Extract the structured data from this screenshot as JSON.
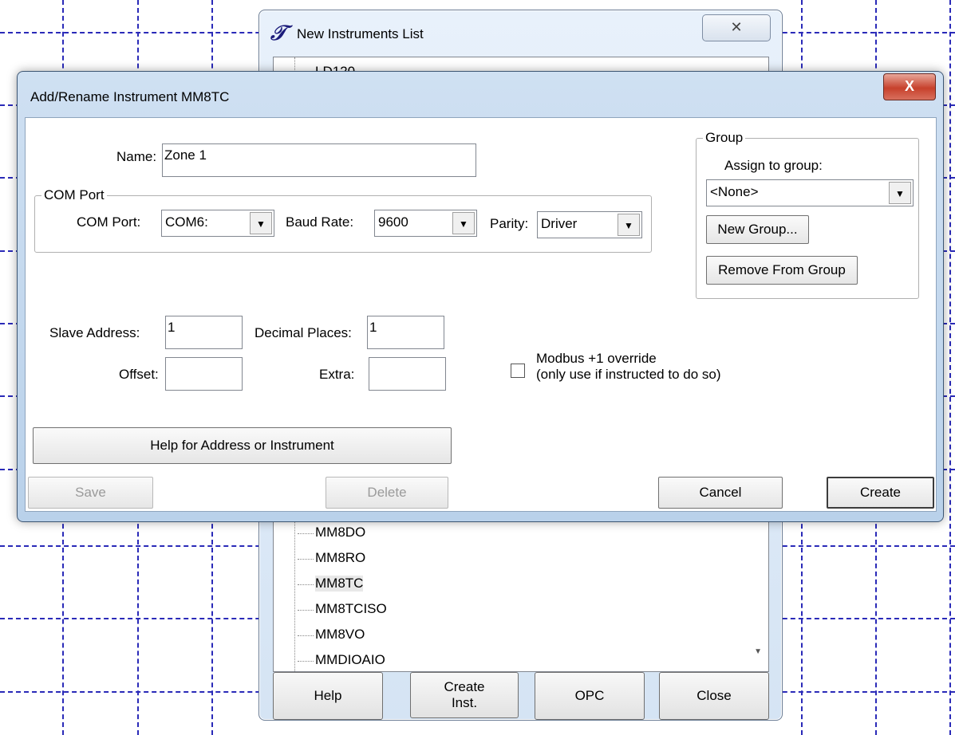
{
  "back_window": {
    "title": "New Instruments List",
    "title_icon": "𝒯",
    "close_glyph": "✕",
    "list_items": [
      {
        "label": "LD120",
        "selected": false
      },
      {
        "label": "MM8DO",
        "selected": false
      },
      {
        "label": "MM8RO",
        "selected": false
      },
      {
        "label": "MM8TC",
        "selected": true
      },
      {
        "label": "MM8TCISO",
        "selected": false
      },
      {
        "label": "MM8VO",
        "selected": false
      },
      {
        "label": "MMDIOAIO",
        "selected": false
      }
    ],
    "buttons": {
      "help": "Help",
      "create_inst": "Create Inst.",
      "opc": "OPC",
      "close": "Close"
    }
  },
  "dialog": {
    "title": "Add/Rename Instrument MM8TC",
    "close_glyph": "X",
    "name_label": "Name:",
    "name_value": "Zone 1",
    "com_group_label": "COM Port",
    "com_port_label": "COM Port:",
    "com_port_value": "COM6:",
    "baud_label": "Baud Rate:",
    "baud_value": "9600",
    "parity_label": "Parity:",
    "parity_value": "Driver",
    "group": {
      "label": "Group",
      "assign_label": "Assign to group:",
      "assign_value": "<None>",
      "new_group": "New Group...",
      "remove_from_group": "Remove From Group"
    },
    "slave_address_label": "Slave Address:",
    "slave_address_value": "1",
    "decimal_places_label": "Decimal Places:",
    "decimal_places_value": "1",
    "offset_label": "Offset:",
    "offset_value": "",
    "extra_label": "Extra:",
    "extra_value": "",
    "modbus_line1": "Modbus +1 override",
    "modbus_line2": "(only use if instructed to do so)",
    "modbus_checked": false,
    "help_button": "Help for Address or  Instrument",
    "save_button": "Save",
    "delete_button": "Delete",
    "cancel_button": "Cancel",
    "create_button": "Create"
  }
}
